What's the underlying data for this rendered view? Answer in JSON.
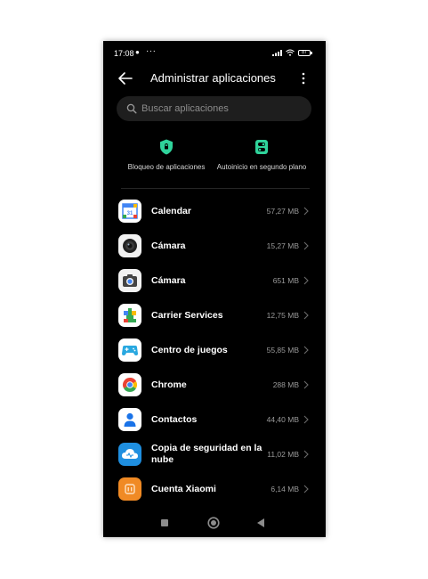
{
  "status_bar": {
    "time": "17:08",
    "battery": "87"
  },
  "header": {
    "title": "Administrar aplicaciones"
  },
  "search": {
    "placeholder": "Buscar aplicaciones"
  },
  "quick_actions": [
    {
      "label": "Bloqueo de aplicaciones",
      "icon": "shield-lock-icon"
    },
    {
      "label": "Autoinicio en segundo plano",
      "icon": "toggle-switch-icon"
    }
  ],
  "apps": [
    {
      "name": "Calendar",
      "size": "57,27 MB",
      "icon": "calendar-app-icon"
    },
    {
      "name": "Cámara",
      "size": "15,27 MB",
      "icon": "camera-lens-app-icon"
    },
    {
      "name": "Cámara",
      "size": "651 MB",
      "icon": "camera-app-icon"
    },
    {
      "name": "Carrier Services",
      "size": "12,75 MB",
      "icon": "carrier-services-app-icon"
    },
    {
      "name": "Centro de juegos",
      "size": "55,85 MB",
      "icon": "gamepad-app-icon"
    },
    {
      "name": "Chrome",
      "size": "288 MB",
      "icon": "chrome-app-icon"
    },
    {
      "name": "Contactos",
      "size": "44,40 MB",
      "icon": "contacts-app-icon"
    },
    {
      "name": "Copia de seguridad en la nube",
      "size": "11,02 MB",
      "icon": "cloud-backup-app-icon"
    },
    {
      "name": "Cuenta Xiaomi",
      "size": "6,14 MB",
      "icon": "xiaomi-account-app-icon"
    }
  ],
  "colors": {
    "background": "#000000",
    "accent": "#2fd39b",
    "search_bg": "#1e1e1e"
  }
}
